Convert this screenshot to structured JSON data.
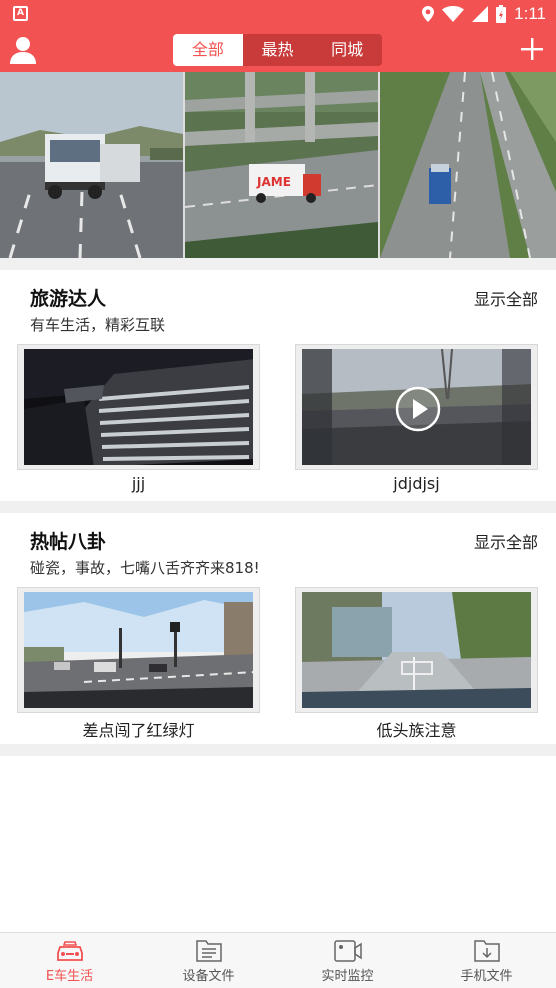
{
  "status_bar": {
    "time": "1:11"
  },
  "top_bar": {
    "tabs": [
      {
        "label": "全部",
        "active": true
      },
      {
        "label": "最热",
        "active": false
      },
      {
        "label": "同城",
        "active": false
      }
    ]
  },
  "banner": {
    "slide_count": 2,
    "active_slide": 1
  },
  "sections": [
    {
      "title": "旅游达人",
      "subtitle": "有车生活，精彩互联",
      "show_all": "显示全部",
      "videos": [
        {
          "caption": "jjj"
        },
        {
          "caption": "jdjdjsj"
        }
      ]
    },
    {
      "title": "热帖八卦",
      "subtitle": "碰瓷，事故，七嘴八舌齐齐来818!",
      "show_all": "显示全部",
      "videos": [
        {
          "caption": "差点闯了红绿灯"
        },
        {
          "caption": "低头族注意"
        }
      ]
    }
  ],
  "bottom_nav": [
    {
      "label": "E车生活",
      "icon": "car-icon",
      "active": true
    },
    {
      "label": "设备文件",
      "icon": "folder-doc-icon",
      "active": false
    },
    {
      "label": "实时监控",
      "icon": "video-camera-icon",
      "active": false
    },
    {
      "label": "手机文件",
      "icon": "folder-download-icon",
      "active": false
    }
  ],
  "colors": {
    "accent": "#f25252",
    "accent_dark": "#c93a3a"
  }
}
